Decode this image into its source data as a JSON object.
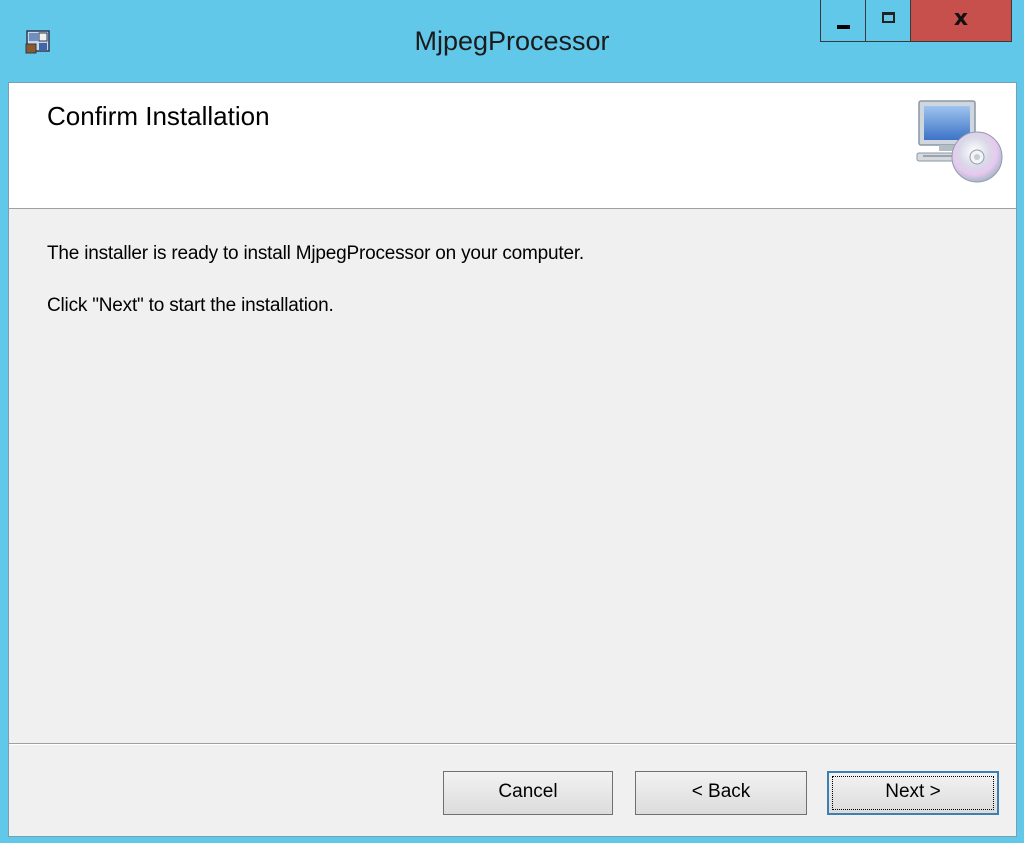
{
  "window": {
    "title": "MjpegProcessor",
    "controls": {
      "minimize_icon": "minimize-icon",
      "maximize_icon": "maximize-icon",
      "close_glyph": "x"
    },
    "accent_color": "#62c8ea",
    "close_color": "#c7504c"
  },
  "banner": {
    "title": "Confirm Installation",
    "icon": "computer-cd-icon"
  },
  "body": {
    "line1": "The installer is ready to install MjpegProcessor on your computer.",
    "line2": "Click \"Next\" to start the installation."
  },
  "buttons": {
    "cancel": "Cancel",
    "back": "< Back",
    "next": "Next >"
  }
}
